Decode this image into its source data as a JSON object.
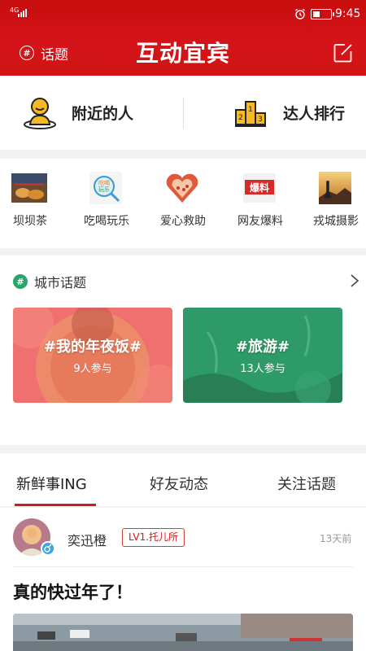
{
  "status_bar": {
    "network": "4G",
    "time": "9:45"
  },
  "header": {
    "topic_label": "话题",
    "title": "互动宜宾"
  },
  "quick_links": [
    {
      "label": "附近的人",
      "icon": "nearby-person-icon"
    },
    {
      "label": "达人排行",
      "icon": "podium-ranking-icon"
    }
  ],
  "categories": [
    {
      "label": "坝坝茶",
      "icon": "tea-thumbnail"
    },
    {
      "label": "吃喝玩乐",
      "icon": "food-fun-thumbnail"
    },
    {
      "label": "爱心救助",
      "icon": "heart-thumbnail"
    },
    {
      "label": "网友爆料",
      "icon": "scoop-thumbnail",
      "badge": "爆料"
    },
    {
      "label": "戎城摄影",
      "icon": "photography-thumbnail"
    }
  ],
  "city_topics": {
    "heading": "城市话题",
    "cards": [
      {
        "title": "#我的年夜饭#",
        "count": "9人参与",
        "color": "#f06a6a"
      },
      {
        "title": "#旅游#",
        "count": "13人参与",
        "color": "#2e9a68"
      }
    ]
  },
  "tabs": [
    {
      "label": "新鲜事ING",
      "active": true
    },
    {
      "label": "好友动态",
      "active": false
    },
    {
      "label": "关注话题",
      "active": false
    }
  ],
  "post": {
    "user": "奕迅橙",
    "level": "LV1.托儿所",
    "time": "13天前",
    "title": "真的快过年了！"
  },
  "colors": {
    "brand_red": "#d21a1a",
    "topic_green": "#2aa66a"
  }
}
